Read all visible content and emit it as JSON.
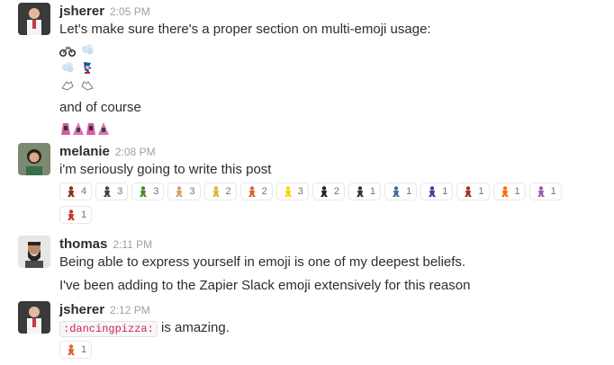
{
  "messages": [
    {
      "author": "jsherer",
      "time": "2:05 PM",
      "text1": "Let's make sure there's a proper section on multi-emoji usage:",
      "emoji_rows": [
        [
          "motorcycle-emoji",
          "dash-cloud-emoji"
        ],
        [
          "dash-cloud-emoji",
          "sonic-emoji"
        ],
        [
          "hands-left-emoji",
          "hands-right-emoji"
        ]
      ],
      "text2": "and of course",
      "trailing_emoji": [
        "pinkhair-emoji",
        "pinkhair-emoji",
        "pinkhair-emoji",
        "pinkhair-emoji"
      ]
    },
    {
      "author": "melanie",
      "time": "2:08 PM",
      "text1": "i'm seriously going to write this post",
      "reactions": [
        {
          "icon": "dancer-red-emoji",
          "count": "4",
          "color": "#8b2b1f"
        },
        {
          "icon": "ninja-emoji",
          "count": "3",
          "color": "#444444"
        },
        {
          "icon": "dancer-green-emoji",
          "count": "3",
          "color": "#4a8a2a"
        },
        {
          "icon": "hand-emoji",
          "count": "3",
          "color": "#d9a066"
        },
        {
          "icon": "dancer-yellow-emoji",
          "count": "2",
          "color": "#e0b030"
        },
        {
          "icon": "pizza-emoji",
          "count": "2",
          "color": "#e06030"
        },
        {
          "icon": "pikachu-emoji",
          "count": "3",
          "color": "#f2d600"
        },
        {
          "icon": "dancer-dark-emoji",
          "count": "2",
          "color": "#222222"
        },
        {
          "icon": "pixel-man-emoji",
          "count": "1",
          "color": "#333333"
        },
        {
          "icon": "pixel-guy-emoji",
          "count": "1",
          "color": "#3a6ea5"
        },
        {
          "icon": "pixel-robot-emoji",
          "count": "1",
          "color": "#4a3a8a"
        },
        {
          "icon": "pixel-car-emoji",
          "count": "1",
          "color": "#a03020"
        },
        {
          "icon": "explosion-emoji",
          "count": "1",
          "color": "#ff6a00"
        },
        {
          "icon": "party-emoji",
          "count": "1",
          "color": "#9b59b6"
        },
        {
          "icon": "mushroom-emoji",
          "count": "1",
          "color": "#c0392b"
        }
      ]
    },
    {
      "author": "thomas",
      "time": "2:11 PM",
      "text1": "Being able to express yourself in emoji is one of my deepest beliefs.",
      "text2": "I've been adding to the Zapier Slack emoji extensively for this reason"
    },
    {
      "author": "jsherer",
      "time": "2:12 PM",
      "code": ":dancingpizza:",
      "text_after_code": " is amazing.",
      "reactions": [
        {
          "icon": "pizza-emoji",
          "count": "1",
          "color": "#e06030"
        }
      ]
    }
  ],
  "colors": {
    "author": "#2c2d30",
    "timestamp": "#9e9ea6",
    "code_text": "#cc2255"
  }
}
